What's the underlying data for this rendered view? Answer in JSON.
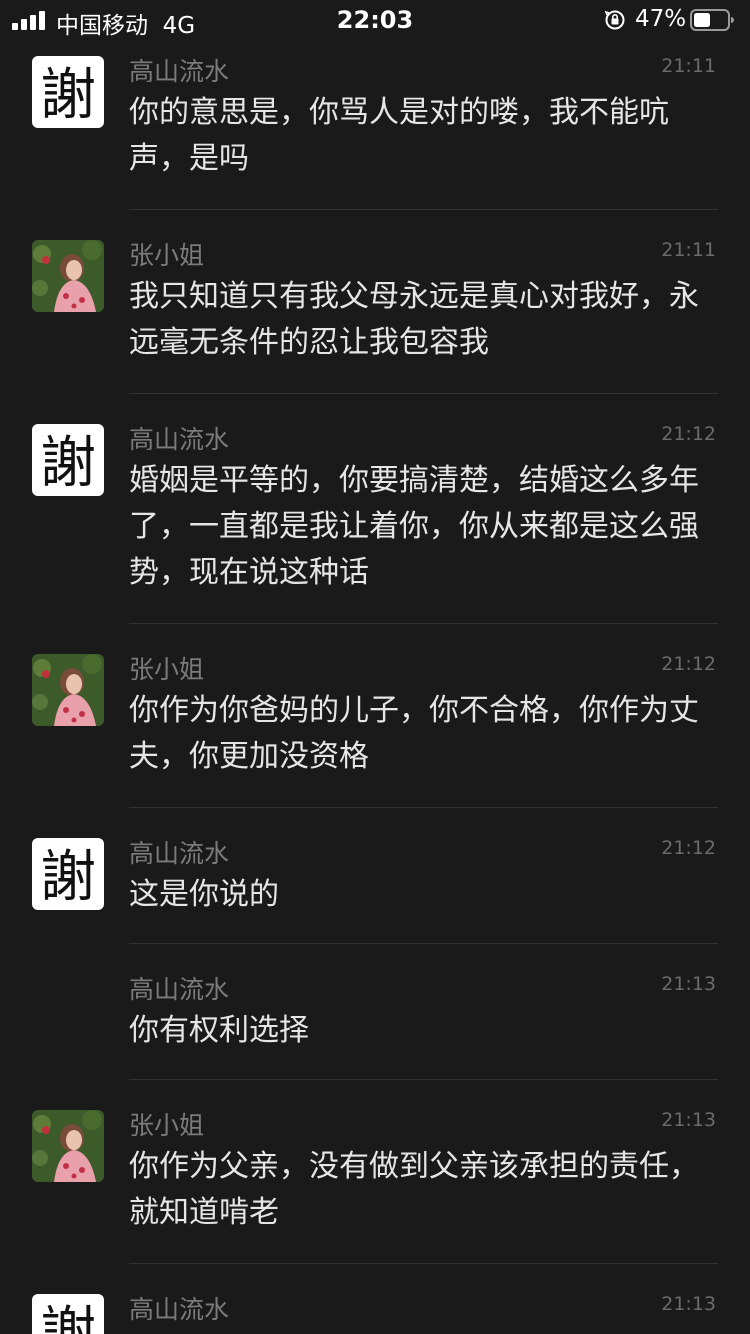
{
  "status_bar": {
    "carrier": "中国移动",
    "network": "4G",
    "time": "22:03",
    "battery_percent": "47%",
    "icons": [
      "signal-icon",
      "orientation-lock-icon",
      "battery-icon"
    ]
  },
  "avatar_glyph": "謝",
  "messages": [
    {
      "sender": "高山流水",
      "time": "21:11",
      "text": "你的意思是，你骂人是对的喽，我不能吭声，是吗",
      "avatar": "xie"
    },
    {
      "sender": "张小姐",
      "time": "21:11",
      "text": "我只知道只有我父母永远是真心对我好，永远毫无条件的忍让我包容我",
      "avatar": "photo"
    },
    {
      "sender": "高山流水",
      "time": "21:12",
      "text": "婚姻是平等的，你要搞清楚，结婚这么多年了，一直都是我让着你，你从来都是这么强势，现在说这种话",
      "avatar": "xie"
    },
    {
      "sender": "张小姐",
      "time": "21:12",
      "text": "你作为你爸妈的儿子，你不合格，你作为丈夫，你更加没资格",
      "avatar": "photo"
    },
    {
      "sender": "高山流水",
      "time": "21:12",
      "text": "这是你说的",
      "avatar": "xie"
    },
    {
      "sender": "高山流水",
      "time": "21:13",
      "text": "你有权利选择",
      "avatar": "none"
    },
    {
      "sender": "张小姐",
      "time": "21:13",
      "text": "你作为父亲，没有做到父亲该承担的责任，就知道啃老",
      "avatar": "photo"
    },
    {
      "sender": "高山流水",
      "time": "21:13",
      "text": "",
      "avatar": "xie"
    }
  ]
}
